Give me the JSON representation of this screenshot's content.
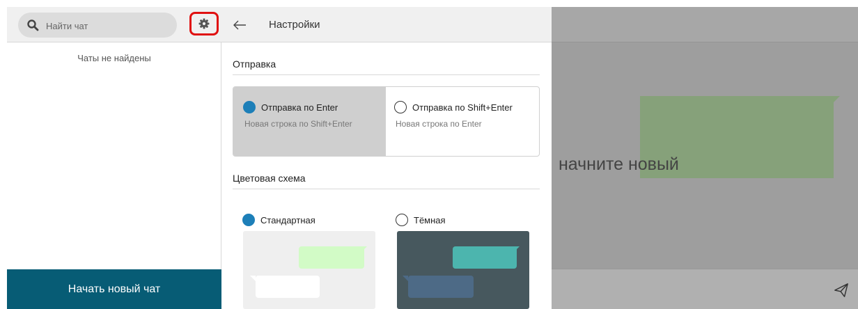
{
  "sidebar": {
    "search_placeholder": "Найти чат",
    "empty_text": "Чаты не найдены",
    "new_chat_label": "Начать новый чат",
    "icons": {
      "search": "search-icon",
      "settings": "gear-icon"
    }
  },
  "settings": {
    "title": "Настройки",
    "back_icon": "arrow-left-icon",
    "sending": {
      "title": "Отправка",
      "options": [
        {
          "label": "Отправка по Enter",
          "description": "Новая строка по Shift+Enter",
          "selected": true
        },
        {
          "label": "Отправка по Shift+Enter",
          "description": "Новая строка по Enter",
          "selected": false
        }
      ]
    },
    "color_scheme": {
      "title": "Цветовая схема",
      "options": [
        {
          "label": "Стандартная",
          "selected": true
        },
        {
          "label": "Тёмная",
          "selected": false
        }
      ]
    }
  },
  "chat": {
    "hint": "начните новый",
    "send_icon": "send-icon"
  },
  "colors": {
    "accent": "#1d7fb8",
    "new_chat_button": "#075c75",
    "highlight_border": "#e01010",
    "standard_outgoing": "#d2fbc6",
    "dark_bg": "#47585e",
    "dark_outgoing": "#4cb5ae",
    "dark_incoming": "#4d6a86"
  }
}
